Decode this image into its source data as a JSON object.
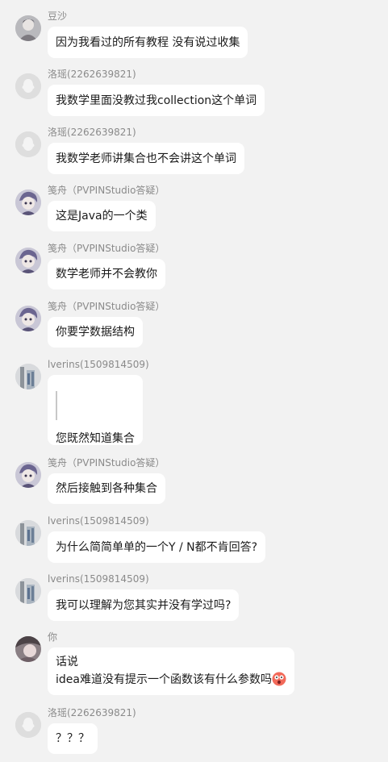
{
  "messages": [
    {
      "sender": "豆沙",
      "avatar": "avatar-dousha",
      "lines": [
        "因为我看过的所有教程 没有说过收集"
      ]
    },
    {
      "sender": "洛瑶(2262639821)",
      "avatar": "avatar-default",
      "lines": [
        "我数学里面没教过我collection这个单词"
      ]
    },
    {
      "sender": "洛瑶(2262639821)",
      "avatar": "avatar-default",
      "lines": [
        "我数学老师讲集合也不会讲这个单词"
      ]
    },
    {
      "sender": "笺舟（PVPINStudio答疑）",
      "avatar": "avatar-jianzhou",
      "lines": [
        "这是Java的一个类"
      ]
    },
    {
      "sender": "笺舟（PVPINStudio答疑）",
      "avatar": "avatar-jianzhou",
      "lines": [
        "数学老师并不会教你"
      ]
    },
    {
      "sender": "笺舟（PVPINStudio答疑）",
      "avatar": "avatar-jianzhou",
      "lines": [
        "你要学数据结构"
      ]
    },
    {
      "sender": "lverins(1509814509)",
      "avatar": "avatar-lverins",
      "lines": [
        "您既然知道集合"
      ],
      "quote": true
    },
    {
      "sender": "笺舟（PVPINStudio答疑）",
      "avatar": "avatar-jianzhou",
      "lines": [
        "然后接触到各种集合"
      ]
    },
    {
      "sender": "lverins(1509814509)",
      "avatar": "avatar-lverins",
      "lines": [
        "为什么简简单单的一个Y / N都不肯回答?"
      ]
    },
    {
      "sender": "lverins(1509814509)",
      "avatar": "avatar-lverins",
      "lines": [
        "我可以理解为您其实并没有学过吗?"
      ]
    },
    {
      "sender": "你",
      "avatar": "avatar-me",
      "lines": [
        "话说",
        "idea难道没有提示一个函数该有什么参数吗"
      ],
      "emoji": "shocked-face-emoji"
    },
    {
      "sender": "洛瑶(2262639821)",
      "avatar": "avatar-default",
      "lines": [
        "？？？"
      ]
    }
  ],
  "colors": {
    "background": "#f2f2f2",
    "bubble": "#ffffff",
    "name": "#8a8a8a",
    "text": "#1a1a1a"
  }
}
